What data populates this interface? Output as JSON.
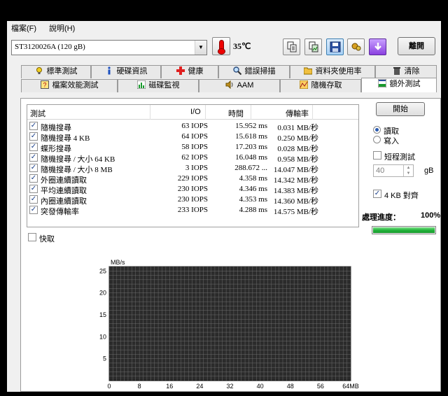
{
  "menubar": {
    "file": "檔案(F)",
    "help": "說明(H)"
  },
  "toolbar": {
    "drive": "ST3120026A (120 gB)",
    "temperature": "35℃",
    "exit_label": "離開",
    "buttons": [
      "copy-text-icon",
      "copy-image-icon",
      "save-icon",
      "options-icon",
      "download-icon"
    ]
  },
  "tabs_top": [
    {
      "label": "標準測試",
      "icon": "lightbulb-icon"
    },
    {
      "label": "硬碟資訊",
      "icon": "info-icon"
    },
    {
      "label": "健康",
      "icon": "health-cross-icon"
    },
    {
      "label": "錯誤掃描",
      "icon": "magnifier-icon"
    },
    {
      "label": "資料夾使用率",
      "icon": "folder-icon"
    },
    {
      "label": "清除",
      "icon": "trash-icon"
    }
  ],
  "tabs_bottom": [
    {
      "label": "檔案效能測試",
      "icon": "file-benchmark-icon"
    },
    {
      "label": "磁碟監視",
      "icon": "disk-monitor-icon"
    },
    {
      "label": "AAM",
      "icon": "speaker-icon"
    },
    {
      "label": "隨機存取",
      "icon": "random-access-icon"
    },
    {
      "label": "額外測試",
      "icon": "extra-tests-icon"
    }
  ],
  "table": {
    "headers": {
      "test": "測試",
      "io": "I/O",
      "time": "時間",
      "rate": "傳輸率"
    },
    "rows": [
      {
        "name": "隨機搜尋",
        "io": "63 IOPS",
        "time": "15.952 ms",
        "rate": "0.031 MB/秒"
      },
      {
        "name": "隨機搜尋 4 KB",
        "io": "64 IOPS",
        "time": "15.618 ms",
        "rate": "0.250 MB/秒"
      },
      {
        "name": "蝶形搜尋",
        "io": "58 IOPS",
        "time": "17.203 ms",
        "rate": "0.028 MB/秒"
      },
      {
        "name": "隨機搜尋 / 大小 64 KB",
        "io": "62 IOPS",
        "time": "16.048 ms",
        "rate": "0.958 MB/秒"
      },
      {
        "name": "隨機搜尋 / 大小 8 MB",
        "io": "3 IOPS",
        "time": "288.672 ...",
        "rate": "14.047 MB/秒"
      },
      {
        "name": "外圈連續讀取",
        "io": "229 IOPS",
        "time": "4.358 ms",
        "rate": "14.342 MB/秒"
      },
      {
        "name": "平均連續讀取",
        "io": "230 IOPS",
        "time": "4.346 ms",
        "rate": "14.383 MB/秒"
      },
      {
        "name": "內圈連續讀取",
        "io": "230 IOPS",
        "time": "4.353 ms",
        "rate": "14.360 MB/秒"
      },
      {
        "name": "突發傳輸率",
        "io": "233 IOPS",
        "time": "4.288 ms",
        "rate": "14.575 MB/秒"
      }
    ]
  },
  "fast_label": "快取",
  "controls": {
    "start_label": "開始",
    "read_label": "讀取",
    "write_label": "寫入",
    "mode": "read",
    "short_test_label": "短程測試",
    "short_test_value": "40",
    "short_test_unit": "gB",
    "align_label": "4 KB 對齊",
    "progress_label": "處理進度：",
    "progress_value": "100%",
    "progress_fraction": 1.0
  },
  "chart_data": {
    "type": "line",
    "ylabel": "MB/s",
    "xlabel": "",
    "x_ticks": [
      "0",
      "8",
      "16",
      "24",
      "32",
      "40",
      "48",
      "56",
      "64MB"
    ],
    "y_ticks": [
      5,
      10,
      15,
      20,
      25
    ],
    "xlim": [
      0,
      64
    ],
    "ylim": [
      0,
      26
    ],
    "grid": true,
    "background": "#2b2b2b",
    "grid_color": "#7a7a7a",
    "series": []
  }
}
